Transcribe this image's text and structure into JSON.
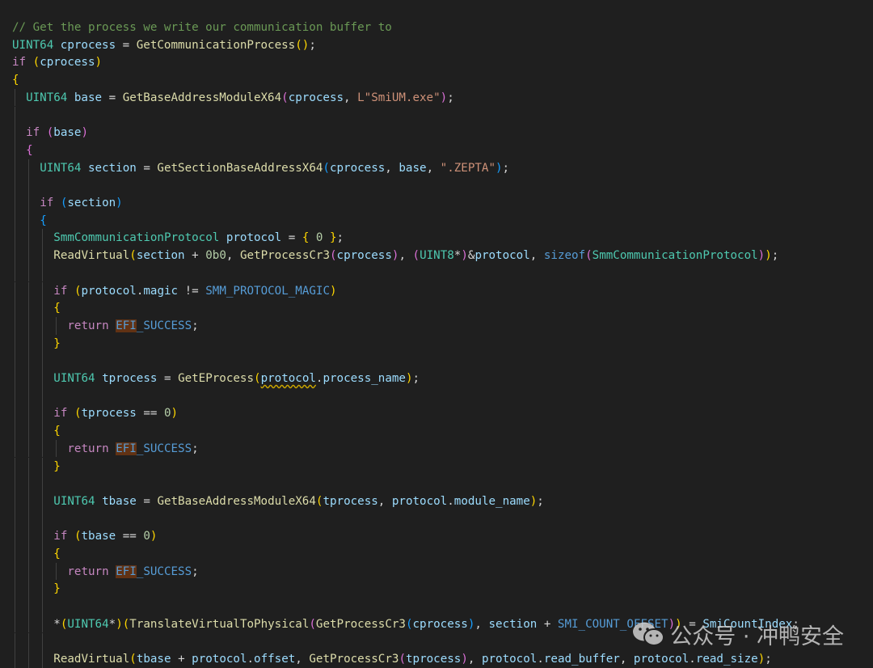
{
  "lines": [
    {
      "indent": 0,
      "tokens": [
        {
          "t": "// Get the process we write our communication buffer to",
          "c": "cmt"
        }
      ]
    },
    {
      "indent": 0,
      "tokens": [
        {
          "t": "UINT64",
          "c": "ty"
        },
        {
          "t": " "
        },
        {
          "t": "cprocess",
          "c": "var"
        },
        {
          "t": " = "
        },
        {
          "t": "GetCommunicationProcess",
          "c": "fn"
        },
        {
          "t": "()",
          "c": "b1"
        },
        {
          "t": ";"
        }
      ]
    },
    {
      "indent": 0,
      "tokens": [
        {
          "t": "if",
          "c": "kw"
        },
        {
          "t": " "
        },
        {
          "t": "(",
          "c": "b1"
        },
        {
          "t": "cprocess",
          "c": "var"
        },
        {
          "t": ")",
          "c": "b1"
        }
      ]
    },
    {
      "indent": 0,
      "tokens": [
        {
          "t": "{",
          "c": "b1"
        }
      ]
    },
    {
      "indent": 1,
      "tokens": [
        {
          "t": "UINT64",
          "c": "ty"
        },
        {
          "t": " "
        },
        {
          "t": "base",
          "c": "var"
        },
        {
          "t": " = "
        },
        {
          "t": "GetBaseAddressModuleX64",
          "c": "fn"
        },
        {
          "t": "(",
          "c": "b2"
        },
        {
          "t": "cprocess",
          "c": "var"
        },
        {
          "t": ", "
        },
        {
          "t": "L\"SmiUM.exe\"",
          "c": "str"
        },
        {
          "t": ")",
          "c": "b2"
        },
        {
          "t": ";"
        }
      ]
    },
    {
      "indent": 1,
      "tokens": []
    },
    {
      "indent": 1,
      "tokens": [
        {
          "t": "if",
          "c": "kw"
        },
        {
          "t": " "
        },
        {
          "t": "(",
          "c": "b2"
        },
        {
          "t": "base",
          "c": "var"
        },
        {
          "t": ")",
          "c": "b2"
        }
      ]
    },
    {
      "indent": 1,
      "tokens": [
        {
          "t": "{",
          "c": "b2"
        }
      ]
    },
    {
      "indent": 2,
      "tokens": [
        {
          "t": "UINT64",
          "c": "ty"
        },
        {
          "t": " "
        },
        {
          "t": "section",
          "c": "var"
        },
        {
          "t": " = "
        },
        {
          "t": "GetSectionBaseAddressX64",
          "c": "fn"
        },
        {
          "t": "(",
          "c": "b3"
        },
        {
          "t": "cprocess",
          "c": "var"
        },
        {
          "t": ", "
        },
        {
          "t": "base",
          "c": "var"
        },
        {
          "t": ", "
        },
        {
          "t": "\".ZEPTA\"",
          "c": "str"
        },
        {
          "t": ")",
          "c": "b3"
        },
        {
          "t": ";"
        }
      ]
    },
    {
      "indent": 2,
      "tokens": []
    },
    {
      "indent": 2,
      "tokens": [
        {
          "t": "if",
          "c": "kw"
        },
        {
          "t": " "
        },
        {
          "t": "(",
          "c": "b3"
        },
        {
          "t": "section",
          "c": "var"
        },
        {
          "t": ")",
          "c": "b3"
        }
      ]
    },
    {
      "indent": 2,
      "tokens": [
        {
          "t": "{",
          "c": "b3"
        }
      ]
    },
    {
      "indent": 3,
      "tokens": [
        {
          "t": "SmmCommunicationProtocol",
          "c": "ty"
        },
        {
          "t": " "
        },
        {
          "t": "protocol",
          "c": "var"
        },
        {
          "t": " = "
        },
        {
          "t": "{",
          "c": "b1"
        },
        {
          "t": " "
        },
        {
          "t": "0",
          "c": "num"
        },
        {
          "t": " "
        },
        {
          "t": "}",
          "c": "b1"
        },
        {
          "t": ";"
        }
      ]
    },
    {
      "indent": 3,
      "tokens": [
        {
          "t": "ReadVirtual",
          "c": "fn"
        },
        {
          "t": "(",
          "c": "b1"
        },
        {
          "t": "section",
          "c": "var"
        },
        {
          "t": " + "
        },
        {
          "t": "0b0",
          "c": "num"
        },
        {
          "t": ", "
        },
        {
          "t": "GetProcessCr3",
          "c": "fn"
        },
        {
          "t": "(",
          "c": "b2"
        },
        {
          "t": "cprocess",
          "c": "var"
        },
        {
          "t": ")",
          "c": "b2"
        },
        {
          "t": ", "
        },
        {
          "t": "(",
          "c": "b2"
        },
        {
          "t": "UINT8",
          "c": "ty"
        },
        {
          "t": "*",
          "c": "op"
        },
        {
          "t": ")",
          "c": "b2"
        },
        {
          "t": "&"
        },
        {
          "t": "protocol",
          "c": "var"
        },
        {
          "t": ", "
        },
        {
          "t": "sizeof",
          "c": "mac"
        },
        {
          "t": "(",
          "c": "b2"
        },
        {
          "t": "SmmCommunicationProtocol",
          "c": "ty"
        },
        {
          "t": ")",
          "c": "b2"
        },
        {
          "t": ")",
          "c": "b1"
        },
        {
          "t": ";"
        }
      ]
    },
    {
      "indent": 3,
      "tokens": []
    },
    {
      "indent": 3,
      "tokens": [
        {
          "t": "if",
          "c": "kw"
        },
        {
          "t": " "
        },
        {
          "t": "(",
          "c": "b1"
        },
        {
          "t": "protocol",
          "c": "var"
        },
        {
          "t": "."
        },
        {
          "t": "magic",
          "c": "var"
        },
        {
          "t": " != "
        },
        {
          "t": "SMM_PROTOCOL_MAGIC",
          "c": "mac"
        },
        {
          "t": ")",
          "c": "b1"
        }
      ]
    },
    {
      "indent": 3,
      "tokens": [
        {
          "t": "{",
          "c": "b1"
        }
      ]
    },
    {
      "indent": 4,
      "tokens": [
        {
          "t": "return",
          "c": "kw"
        },
        {
          "t": " "
        },
        {
          "t": "EFI",
          "c": "mac hl"
        },
        {
          "t": "_SUCCESS",
          "c": "mac"
        },
        {
          "t": ";"
        }
      ]
    },
    {
      "indent": 3,
      "tokens": [
        {
          "t": "}",
          "c": "b1"
        }
      ]
    },
    {
      "indent": 3,
      "tokens": []
    },
    {
      "indent": 3,
      "tokens": [
        {
          "t": "UINT64",
          "c": "ty"
        },
        {
          "t": " "
        },
        {
          "t": "tprocess",
          "c": "var"
        },
        {
          "t": " = "
        },
        {
          "t": "GetEProcess",
          "c": "fn"
        },
        {
          "t": "(",
          "c": "b1"
        },
        {
          "t": "protocol",
          "c": "var squig"
        },
        {
          "t": "."
        },
        {
          "t": "process_name",
          "c": "var"
        },
        {
          "t": ")",
          "c": "b1"
        },
        {
          "t": ";"
        }
      ]
    },
    {
      "indent": 3,
      "tokens": []
    },
    {
      "indent": 3,
      "tokens": [
        {
          "t": "if",
          "c": "kw"
        },
        {
          "t": " "
        },
        {
          "t": "(",
          "c": "b1"
        },
        {
          "t": "tprocess",
          "c": "var"
        },
        {
          "t": " == "
        },
        {
          "t": "0",
          "c": "num"
        },
        {
          "t": ")",
          "c": "b1"
        }
      ]
    },
    {
      "indent": 3,
      "tokens": [
        {
          "t": "{",
          "c": "b1"
        }
      ]
    },
    {
      "indent": 4,
      "tokens": [
        {
          "t": "return",
          "c": "kw"
        },
        {
          "t": " "
        },
        {
          "t": "EFI",
          "c": "mac hl"
        },
        {
          "t": "_SUCCESS",
          "c": "mac"
        },
        {
          "t": ";"
        }
      ]
    },
    {
      "indent": 3,
      "tokens": [
        {
          "t": "}",
          "c": "b1"
        }
      ]
    },
    {
      "indent": 3,
      "tokens": []
    },
    {
      "indent": 3,
      "tokens": [
        {
          "t": "UINT64",
          "c": "ty"
        },
        {
          "t": " "
        },
        {
          "t": "tbase",
          "c": "var"
        },
        {
          "t": " = "
        },
        {
          "t": "GetBaseAddressModuleX64",
          "c": "fn"
        },
        {
          "t": "(",
          "c": "b1"
        },
        {
          "t": "tprocess",
          "c": "var"
        },
        {
          "t": ", "
        },
        {
          "t": "protocol",
          "c": "var"
        },
        {
          "t": "."
        },
        {
          "t": "module_name",
          "c": "var"
        },
        {
          "t": ")",
          "c": "b1"
        },
        {
          "t": ";"
        }
      ]
    },
    {
      "indent": 3,
      "tokens": []
    },
    {
      "indent": 3,
      "tokens": [
        {
          "t": "if",
          "c": "kw"
        },
        {
          "t": " "
        },
        {
          "t": "(",
          "c": "b1"
        },
        {
          "t": "tbase",
          "c": "var"
        },
        {
          "t": " == "
        },
        {
          "t": "0",
          "c": "num"
        },
        {
          "t": ")",
          "c": "b1"
        }
      ]
    },
    {
      "indent": 3,
      "tokens": [
        {
          "t": "{",
          "c": "b1"
        }
      ]
    },
    {
      "indent": 4,
      "tokens": [
        {
          "t": "return",
          "c": "kw"
        },
        {
          "t": " "
        },
        {
          "t": "EFI",
          "c": "mac hl"
        },
        {
          "t": "_SUCCESS",
          "c": "mac"
        },
        {
          "t": ";"
        }
      ]
    },
    {
      "indent": 3,
      "tokens": [
        {
          "t": "}",
          "c": "b1"
        }
      ]
    },
    {
      "indent": 3,
      "tokens": []
    },
    {
      "indent": 3,
      "tokens": [
        {
          "t": "*"
        },
        {
          "t": "(",
          "c": "b1"
        },
        {
          "t": "UINT64",
          "c": "ty"
        },
        {
          "t": "*"
        },
        {
          "t": ")",
          "c": "b1"
        },
        {
          "t": "(",
          "c": "b1"
        },
        {
          "t": "TranslateVirtualToPhysical",
          "c": "fn"
        },
        {
          "t": "(",
          "c": "b2"
        },
        {
          "t": "GetProcessCr3",
          "c": "fn"
        },
        {
          "t": "(",
          "c": "b3"
        },
        {
          "t": "cprocess",
          "c": "var"
        },
        {
          "t": ")",
          "c": "b3"
        },
        {
          "t": ", "
        },
        {
          "t": "section",
          "c": "var"
        },
        {
          "t": " + "
        },
        {
          "t": "SMI_COUNT_OFFSET",
          "c": "mac"
        },
        {
          "t": ")",
          "c": "b2"
        },
        {
          "t": ")",
          "c": "b1"
        },
        {
          "t": " = "
        },
        {
          "t": "SmiCountIndex",
          "c": "var"
        },
        {
          "t": ";"
        }
      ]
    },
    {
      "indent": 3,
      "tokens": []
    },
    {
      "indent": 3,
      "tokens": [
        {
          "t": "ReadVirtual",
          "c": "fn"
        },
        {
          "t": "(",
          "c": "b1"
        },
        {
          "t": "tbase",
          "c": "var"
        },
        {
          "t": " + "
        },
        {
          "t": "protocol",
          "c": "var"
        },
        {
          "t": "."
        },
        {
          "t": "offset",
          "c": "var"
        },
        {
          "t": ", "
        },
        {
          "t": "GetProcessCr3",
          "c": "fn"
        },
        {
          "t": "(",
          "c": "b2"
        },
        {
          "t": "tprocess",
          "c": "var"
        },
        {
          "t": ")",
          "c": "b2"
        },
        {
          "t": ", "
        },
        {
          "t": "protocol",
          "c": "var"
        },
        {
          "t": "."
        },
        {
          "t": "read_buffer",
          "c": "var"
        },
        {
          "t": ", "
        },
        {
          "t": "protocol",
          "c": "var"
        },
        {
          "t": "."
        },
        {
          "t": "read_size",
          "c": "var"
        },
        {
          "t": ")",
          "c": "b1"
        },
        {
          "t": ";"
        }
      ]
    }
  ],
  "watermark": {
    "text": "公众号 · 冲鸭安全",
    "icon": "wechat-icon"
  }
}
